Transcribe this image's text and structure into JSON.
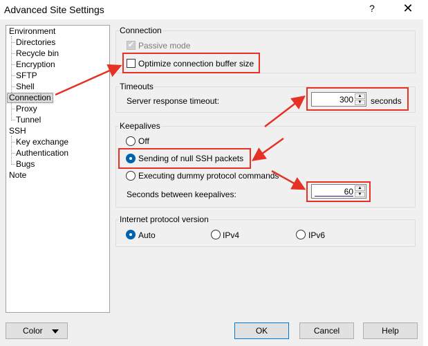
{
  "window": {
    "title": "Advanced Site Settings",
    "help_label": "?",
    "close_label": "✕"
  },
  "tree": {
    "items": [
      "Environment",
      "Directories",
      "Recycle bin",
      "Encryption",
      "SFTP",
      "Shell",
      "Connection",
      "Proxy",
      "Tunnel",
      "SSH",
      "Key exchange",
      "Authentication",
      "Bugs",
      "Note"
    ],
    "selected": "Connection"
  },
  "connection": {
    "title": "Connection",
    "passive_mode": {
      "label": "Passive mode",
      "checked": true,
      "enabled": false
    },
    "optimize_buffer": {
      "label": "Optimize connection buffer size",
      "checked": false
    }
  },
  "timeouts": {
    "title": "Timeouts",
    "label": "Server response timeout:",
    "value": "300",
    "unit": "seconds"
  },
  "keepalives": {
    "title": "Keepalives",
    "options": [
      "Off",
      "Sending of null SSH packets",
      "Executing dummy protocol commands"
    ],
    "selected": "Sending of null SSH packets",
    "interval_label": "Seconds between keepalives:",
    "interval_value": "60"
  },
  "ip_version": {
    "title": "Internet protocol version",
    "options": [
      "Auto",
      "IPv4",
      "IPv6"
    ],
    "selected": "Auto"
  },
  "buttons": {
    "color": "Color",
    "ok": "OK",
    "cancel": "Cancel",
    "help": "Help"
  },
  "colors": {
    "highlight": "#e53224",
    "accent": "#0063b1"
  }
}
